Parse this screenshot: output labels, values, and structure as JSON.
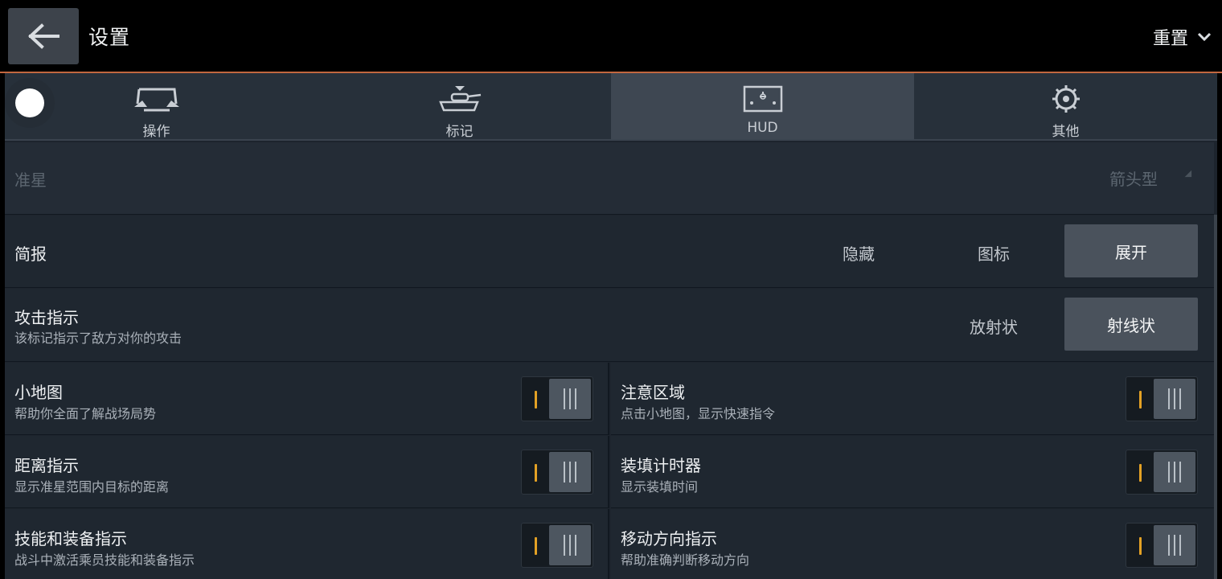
{
  "header": {
    "title": "设置",
    "reset_label": "重置"
  },
  "tabs": [
    {
      "label": "操作",
      "icon": "controls-icon",
      "active": false
    },
    {
      "label": "标记",
      "icon": "tank-marker-icon",
      "active": false
    },
    {
      "label": "HUD",
      "icon": "hud-screen-icon",
      "active": true
    },
    {
      "label": "其他",
      "icon": "gear-icon",
      "active": false
    }
  ],
  "crosshair": {
    "title": "准星",
    "value": "箭头型"
  },
  "briefing": {
    "title": "简报",
    "options": [
      "隐藏",
      "图标",
      "展开"
    ],
    "selected": "展开"
  },
  "attack": {
    "title": "攻击指示",
    "subtitle": "该标记指示了敌方对你的攻击",
    "options": [
      "放射状",
      "射线状"
    ],
    "selected": "射线状"
  },
  "toggles": [
    {
      "title": "小地图",
      "subtitle": "帮助你全面了解战场局势",
      "on": true
    },
    {
      "title": "注意区域",
      "subtitle": "点击小地图，显示快速指令",
      "on": true
    },
    {
      "title": "距离指示",
      "subtitle": "显示准星范围内目标的距离",
      "on": true
    },
    {
      "title": "装填计时器",
      "subtitle": "显示装填时间",
      "on": true
    },
    {
      "title": "技能和装备指示",
      "subtitle": "战斗中激活乘员技能和装备指示",
      "on": true
    },
    {
      "title": "移动方向指示",
      "subtitle": "帮助准确判断移动方向",
      "on": true
    }
  ],
  "colors": {
    "accent_orange": "#e3a125",
    "divider": "#c2673f"
  }
}
